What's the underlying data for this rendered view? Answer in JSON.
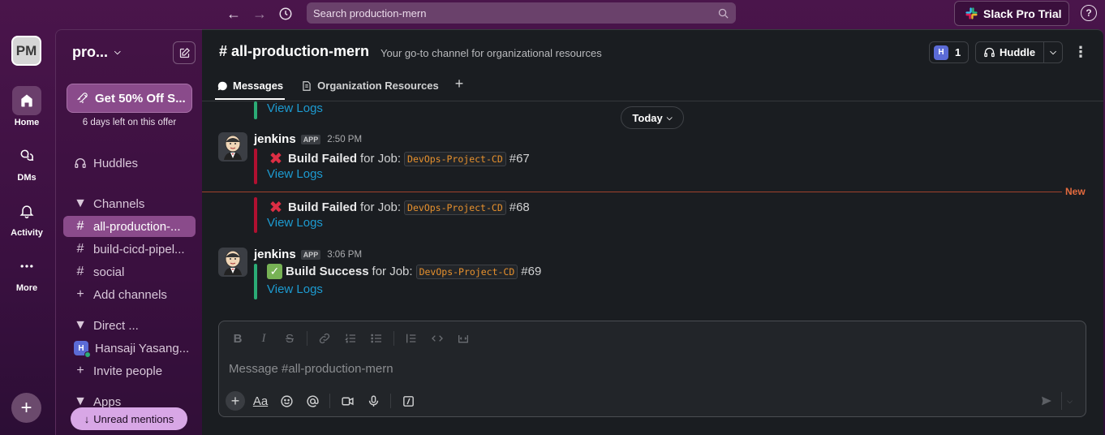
{
  "topbar": {
    "search_placeholder": "Search production-mern",
    "pro_trial_label": "Slack Pro Trial",
    "help_label": "?"
  },
  "rail": {
    "workspace_initials": "PM",
    "items": [
      {
        "label": "Home",
        "icon": "home-icon"
      },
      {
        "label": "DMs",
        "icon": "dm-icon"
      },
      {
        "label": "Activity",
        "icon": "bell-icon"
      },
      {
        "label": "More",
        "icon": "more-icon"
      }
    ]
  },
  "sidebar": {
    "workspace_name": "pro...",
    "offer_label": "Get 50% Off S...",
    "offer_note": "6 days left on this offer",
    "huddles_label": "Huddles",
    "channels_header": "Channels",
    "channels": [
      "all-production-...",
      "build-cicd-pipel...",
      "social"
    ],
    "add_channels_label": "Add channels",
    "direct_header": "Direct ...",
    "dm_user": {
      "initial": "H",
      "name": "Hansaji Yasang..."
    },
    "invite_label": "Invite people",
    "apps_header": "Apps",
    "unread_mentions_label": "Unread mentions"
  },
  "channel": {
    "title": "# all-production-mern",
    "description": "Your go-to channel for organizational resources",
    "member_initial": "H",
    "member_count": "1",
    "huddle_label": "Huddle",
    "tabs": [
      {
        "label": "Messages",
        "active": true
      },
      {
        "label": "Organization Resources",
        "active": false
      }
    ]
  },
  "feed": {
    "partial_view_logs": "View Logs",
    "today_label": "Today",
    "new_label": "New",
    "messages": [
      {
        "author": "jenkins",
        "badge": "APP",
        "time": "2:50 PM",
        "status": "Build Failed",
        "mid": "for Job:",
        "job": "DevOps-Project-CD",
        "build": "#67",
        "link": "View Logs",
        "kind": "fail"
      },
      {
        "status": "Build Failed",
        "mid": "for Job:",
        "job": "DevOps-Project-CD",
        "build": "#68",
        "link": "View Logs",
        "kind": "fail"
      },
      {
        "author": "jenkins",
        "badge": "APP",
        "time": "3:06 PM",
        "status": "Build Success",
        "mid": "for Job:",
        "job": "DevOps-Project-CD",
        "build": "#69",
        "link": "View Logs",
        "kind": "success"
      }
    ]
  },
  "composer": {
    "placeholder": "Message #all-production-mern",
    "text_style_label": "Aa"
  },
  "colors": {
    "accent": "#8a4b8b",
    "link": "#1d9bd1",
    "fail_bar": "#b01030",
    "success_bar": "#2bac76",
    "new_divider": "#e36a3e",
    "code": "#e8912d"
  }
}
